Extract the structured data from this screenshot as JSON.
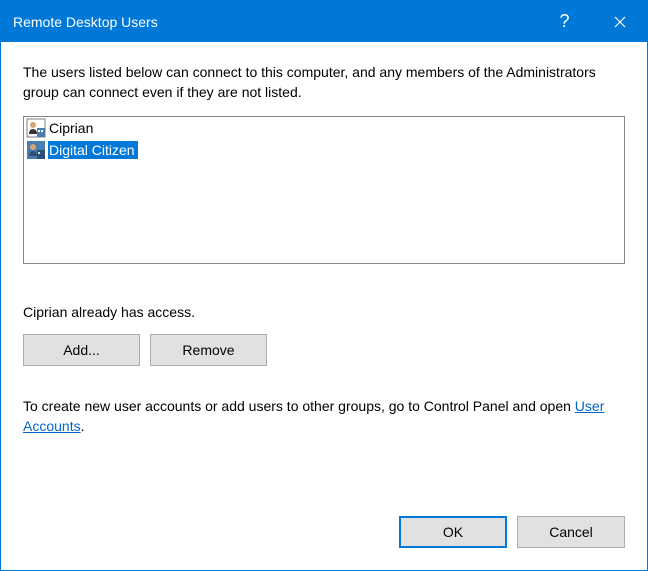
{
  "titlebar": {
    "title": "Remote Desktop Users"
  },
  "content": {
    "description": "The users listed below can connect to this computer, and any members of the Administrators group can connect even if they are not listed.",
    "users": [
      {
        "name": "Ciprian",
        "selected": false
      },
      {
        "name": "Digital Citizen",
        "selected": true
      }
    ],
    "access_text": "Ciprian already has access.",
    "buttons": {
      "add": "Add...",
      "remove": "Remove"
    },
    "info_prefix": "To create new user accounts or add users to other groups, go to Control Panel and open ",
    "info_link": "User Accounts",
    "info_suffix": "."
  },
  "footer": {
    "ok": "OK",
    "cancel": "Cancel"
  }
}
